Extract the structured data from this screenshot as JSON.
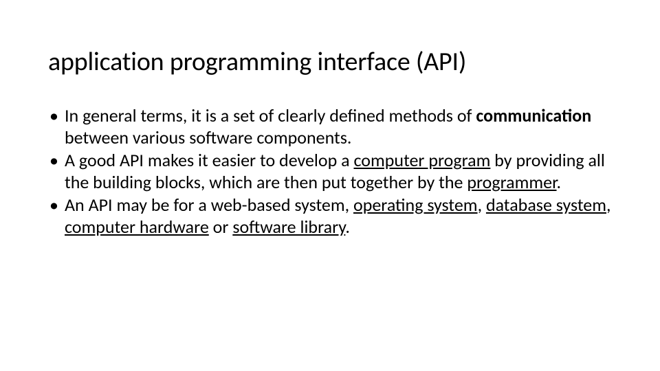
{
  "title": "application programming interface (API)",
  "bullets": {
    "b1": {
      "pre": "In general terms, it is a set of clearly defined methods of ",
      "bold": "communication",
      "post": " between various software components."
    },
    "b2": {
      "p1": "A good API makes it easier to develop a ",
      "u1": "computer program",
      "p2": " by providing all the building blocks, which are then put together by the ",
      "u2": "programmer",
      "p3": "."
    },
    "b3": {
      "p1": "An API may be for a web-based system, ",
      "u1": "operating system",
      "p2": ", ",
      "u2": "database system",
      "p3": ", ",
      "u3": "computer hardware",
      "p4": " or ",
      "u4": "software library",
      "p5": "."
    }
  },
  "dot": "•"
}
